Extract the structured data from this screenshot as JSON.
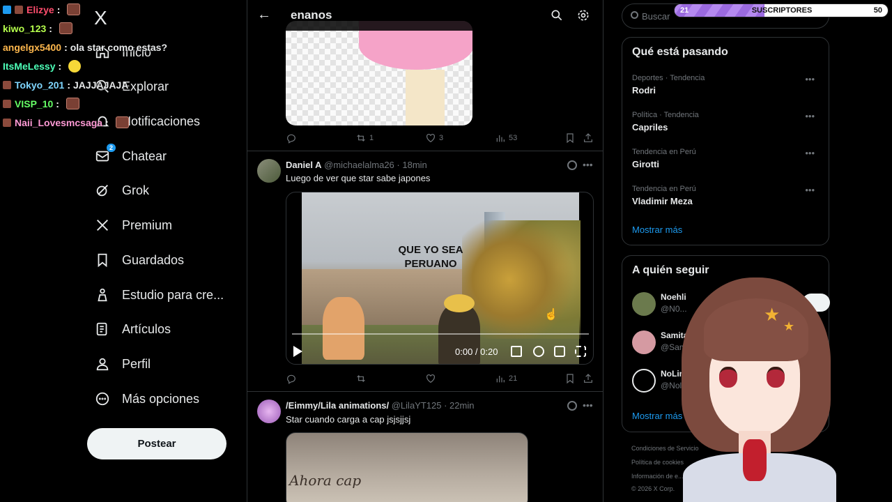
{
  "chat": [
    {
      "user": "Elizye",
      "color": "#ff4d6d",
      "emote": "emote",
      "badge": true,
      "badge2": true
    },
    {
      "user": "kiwo_123",
      "color": "#b6ff4d",
      "emote": "emote"
    },
    {
      "user": "angelgx5400",
      "color": "#ffb84d",
      "message": "ola star como estas?"
    },
    {
      "user": "ItsMeLessy",
      "color": "#4dffb8",
      "emote": "smile"
    },
    {
      "user": "Tokyo_201",
      "color": "#7fd6ff",
      "message": "JAJJAJAJA",
      "badge": true
    },
    {
      "user": "VISP_10",
      "color": "#66ff66",
      "emote": "emote",
      "badge": true
    },
    {
      "user": "Naii_Lovesmcsaga",
      "color": "#ff9ad5",
      "emote": "emote",
      "badge": true
    }
  ],
  "nav": {
    "logo": "X",
    "items": [
      {
        "label": "Inicio",
        "icon": "home-icon"
      },
      {
        "label": "Explorar",
        "icon": "search-icon"
      },
      {
        "label": "Notificaciones",
        "icon": "bell-icon"
      },
      {
        "label": "Chatear",
        "icon": "mail-icon",
        "badge": "2"
      },
      {
        "label": "Grok",
        "icon": "grok-icon"
      },
      {
        "label": "Premium",
        "icon": "x-icon"
      },
      {
        "label": "Guardados",
        "icon": "bookmark-icon"
      },
      {
        "label": "Estudio para cre...",
        "icon": "studio-icon"
      },
      {
        "label": "Artículos",
        "icon": "article-icon"
      },
      {
        "label": "Perfil",
        "icon": "person-icon"
      },
      {
        "label": "Más opciones",
        "icon": "more-circle-icon"
      }
    ],
    "post_label": "Postear"
  },
  "timeline": {
    "title": "enanos",
    "post1": {
      "reply": "",
      "retweet": "1",
      "like": "3",
      "views": "53"
    },
    "post2": {
      "name": "Daniel A",
      "handle": "@michaelalma26",
      "time": "· 18min",
      "text": "Luego de ver que star sabe japones",
      "caption_line1": "QUE YO SEA",
      "caption_line2": "PERUANO",
      "video_time": "0:00 / 0:20",
      "progress": 0,
      "reply": "",
      "retweet": "",
      "like": "",
      "views": "21"
    },
    "post3": {
      "name": "/Eimmy/Lila animations/",
      "handle": "@LilaYT125",
      "time": "· 22min",
      "text": "Star cuando carga a cap jsjsjjsj",
      "image_text": "Ahora cap"
    }
  },
  "right": {
    "search_placeholder": "Buscar",
    "trends_title": "Qué está pasando",
    "trends": [
      {
        "meta": "Deportes · Tendencia",
        "name": "Rodri"
      },
      {
        "meta": "Política · Tendencia",
        "name": "Capriles"
      },
      {
        "meta": "Tendencia en Perú",
        "name": "Girotti"
      },
      {
        "meta": "Tendencia en Perú",
        "name": "Vladimir Meza"
      }
    ],
    "show_more": "Mostrar más",
    "follow_title": "A quién seguir",
    "follow": [
      {
        "name": "Noehli",
        "handle": "@N0..."
      },
      {
        "name": "Samita",
        "handle": "@Sami..."
      },
      {
        "name": "NoLim",
        "handle": "@Nol..."
      }
    ],
    "follow_more": "Mostrar más",
    "footer": [
      "Condiciones de Servicio",
      "Política de cookies",
      "Información de e...",
      "© 2026 X Corp."
    ]
  },
  "subs": {
    "current": "21",
    "label": "SUSCRIPTORES",
    "goal": "50",
    "progress": 0.42
  },
  "colors": {
    "accent": "#1d9bf0",
    "bg": "#000000",
    "border": "#2f3336",
    "subs_fill": "#9b6ae0"
  }
}
